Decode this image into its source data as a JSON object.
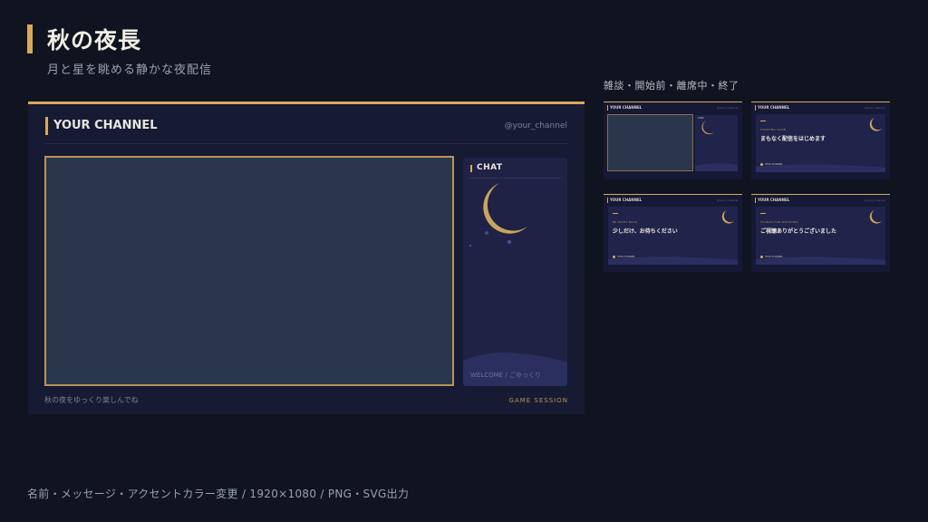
{
  "header": {
    "title": "秋の夜長",
    "subtitle": "月と星を眺める静かな夜配信"
  },
  "variants_label": "雑談・開始前・離席中・終了",
  "preview": {
    "channel_name": "YOUR CHANNEL",
    "handle": "@your_channel",
    "chat_title": "CHAT",
    "welcome": "WELCOME / ごゆっくり",
    "bottom_message": "秋の夜をゆっくり楽しんでね",
    "game_session": "GAME SESSION"
  },
  "thumbnails": [
    {
      "type": "chat",
      "channel_name": "YOUR CHANNEL",
      "handle": "@your_channel",
      "chat_title": "CHAT",
      "footer_left": "",
      "footer_right": ""
    },
    {
      "type": "scene",
      "channel_name": "YOUR CHANNEL",
      "handle": "@your_channel",
      "eyebrow": "STARTING SOON",
      "heading": "まもなく配信をはじめます",
      "sub": "",
      "tag": "YOUR CHANNEL",
      "footer_left": "",
      "footer_right": ""
    },
    {
      "type": "scene",
      "channel_name": "YOUR CHANNEL",
      "handle": "@your_channel",
      "eyebrow": "BE RIGHT BACK",
      "heading": "少しだけ、お待ちください",
      "sub": "",
      "tag": "YOUR CHANNEL",
      "footer_left": "",
      "footer_right": ""
    },
    {
      "type": "scene",
      "channel_name": "YOUR CHANNEL",
      "handle": "@your_channel",
      "eyebrow": "THANKS FOR WATCHING",
      "heading": "ご視聴ありがとうございました",
      "sub": "",
      "tag": "YOUR CHANNEL",
      "footer_left": "",
      "footer_right": ""
    }
  ],
  "footer": "名前・メッセージ・アクセントカラー変更 / 1920×1080 / PNG・SVG出力",
  "colors": {
    "background": "#0f1420",
    "accent": "#d9a85b",
    "panel": "#161a33",
    "video": "#2a364b",
    "moon": "#c9a45e"
  }
}
